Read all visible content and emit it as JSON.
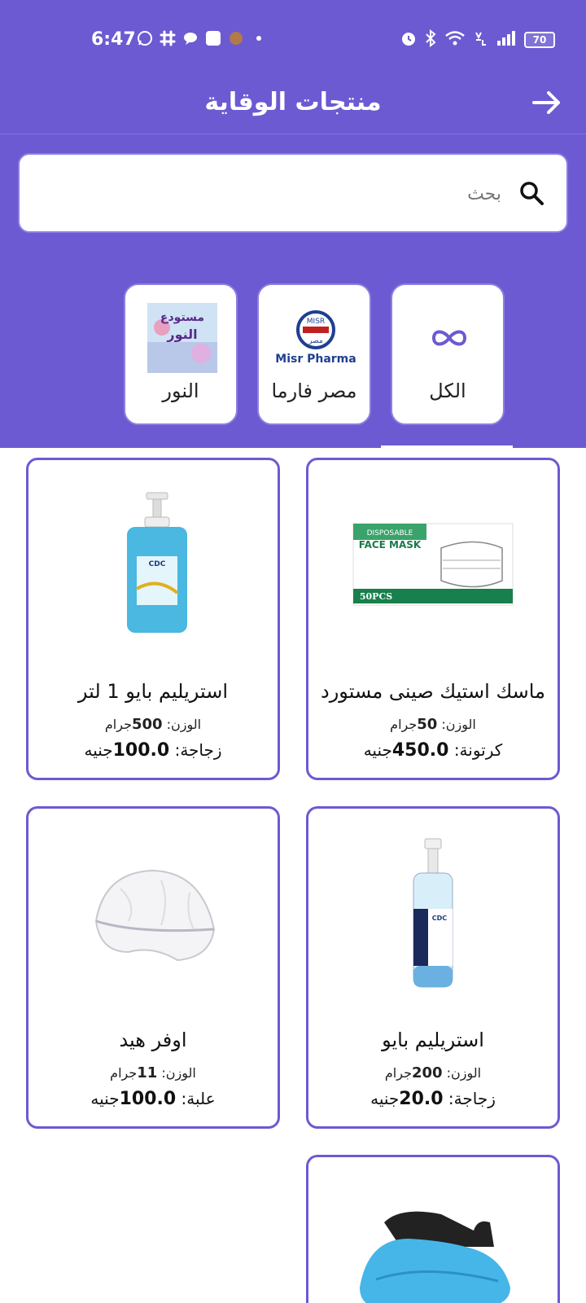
{
  "status": {
    "time": "6:47",
    "battery": "70"
  },
  "header": {
    "title": "منتجات الوقاية"
  },
  "search": {
    "placeholder": "بحث"
  },
  "categories": [
    {
      "label": "الكل",
      "icon": "infinity-icon"
    },
    {
      "label": "مصر فارما",
      "logo_text": "Misr Pharma"
    },
    {
      "label": "النور",
      "logo_text": "مستودع النور"
    }
  ],
  "products": [
    {
      "name": "ماسك استيك صينى مستورد",
      "weight_label": "الوزن:",
      "weight_value": "50",
      "weight_unit": "جرام",
      "unit": "كرتونة:",
      "price": "450.0",
      "currency": "جنيه",
      "image": "face-mask-box"
    },
    {
      "name": "استريليم بايو 1 لتر",
      "weight_label": "الوزن:",
      "weight_value": "500",
      "weight_unit": "جرام",
      "unit": "زجاجة:",
      "price": "100.0",
      "currency": "جنيه",
      "image": "sanitizer-bottle-large"
    },
    {
      "name": "استريليم بايو",
      "weight_label": "الوزن:",
      "weight_value": "200",
      "weight_unit": "جرام",
      "unit": "زجاجة:",
      "price": "20.0",
      "currency": "جنيه",
      "image": "spray-bottle"
    },
    {
      "name": "اوفر هيد",
      "weight_label": "الوزن:",
      "weight_value": "11",
      "weight_unit": "جرام",
      "unit": "علبة:",
      "price": "100.0",
      "currency": "جنيه",
      "image": "hair-cap"
    },
    {
      "name": "",
      "image": "shoe-cover"
    }
  ],
  "colors": {
    "brand": "#6c5ad2",
    "card_border": "#6c5ad2",
    "background": "#ffffff"
  },
  "product_image_text": {
    "mask_box_top": "DISPOSABLE",
    "mask_box_main": "FACE MASK",
    "mask_box_count": "50PCS",
    "bottle_brand": "CDC"
  }
}
